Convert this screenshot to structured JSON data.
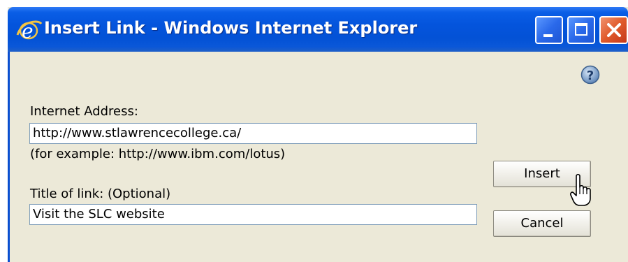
{
  "window": {
    "title": "Insert Link - Windows Internet Explorer",
    "icon": "ie-logo-icon",
    "controls": [
      "minimize-icon",
      "maximize-icon",
      "close-icon"
    ]
  },
  "form": {
    "help_icon": "help-icon",
    "address_label": "Internet Address:",
    "address_value": "http://www.stlawrencecollege.ca/",
    "address_example": "(for example: http://www.ibm.com/lotus)",
    "title_label": "Title of link: (Optional)",
    "title_value": "Visit the SLC website"
  },
  "buttons": {
    "insert": "Insert",
    "cancel": "Cancel"
  },
  "colors": {
    "titlebar": "#0454dc",
    "close_button": "#e05a2b",
    "dialog_bg": "#ece9d8"
  }
}
